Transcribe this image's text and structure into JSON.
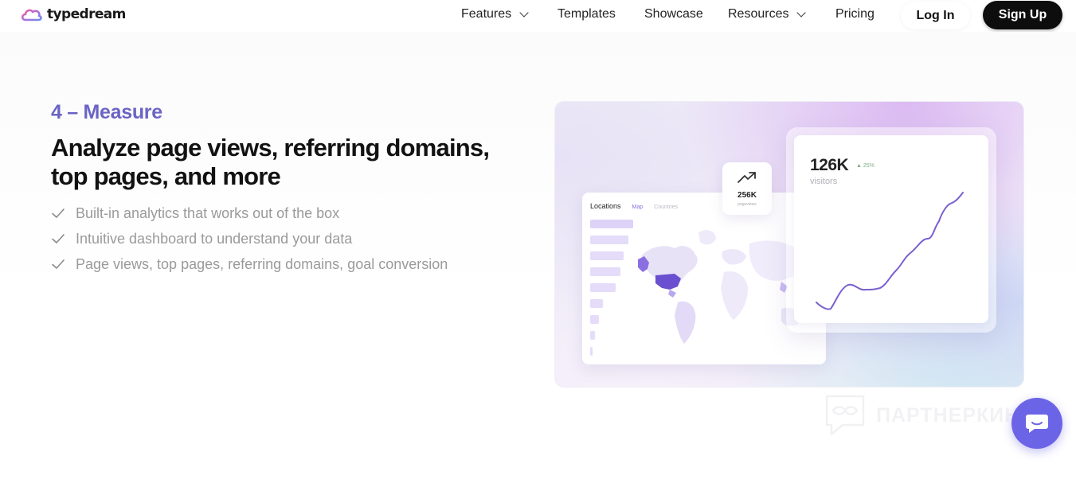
{
  "nav": {
    "logo_text": "typedream",
    "items": [
      {
        "label": "Features",
        "has_dropdown": true
      },
      {
        "label": "Templates",
        "has_dropdown": false
      },
      {
        "label": "Showcase",
        "has_dropdown": false
      },
      {
        "label": "Resources",
        "has_dropdown": true
      },
      {
        "label": "Pricing",
        "has_dropdown": false
      }
    ],
    "login_label": "Log In",
    "signup_label": "Sign Up"
  },
  "section": {
    "step_label": "4 – Measure",
    "headline": "Analyze page views, referring domains, top pages, and more",
    "features": [
      "Built-in analytics that works out of the box",
      "Intuitive dashboard to understand your data",
      "Page views, top pages, referring domains, goal conversion"
    ]
  },
  "illustration": {
    "map_card": {
      "tabs": [
        "Locations",
        "Map",
        "Countries"
      ]
    },
    "pageviews_card": {
      "value": "256K",
      "label": "pageviews"
    },
    "visitors_card": {
      "value": "126K",
      "badge": "▲ 25%",
      "label": "visitors"
    }
  },
  "watermark_text": "ПАРТНЕРКИН",
  "colors": {
    "accent": "#6b64c4",
    "signup_bg": "#0d0d0d",
    "chat_button": "#6b64e6",
    "chart_line": "#7a5fd0"
  }
}
